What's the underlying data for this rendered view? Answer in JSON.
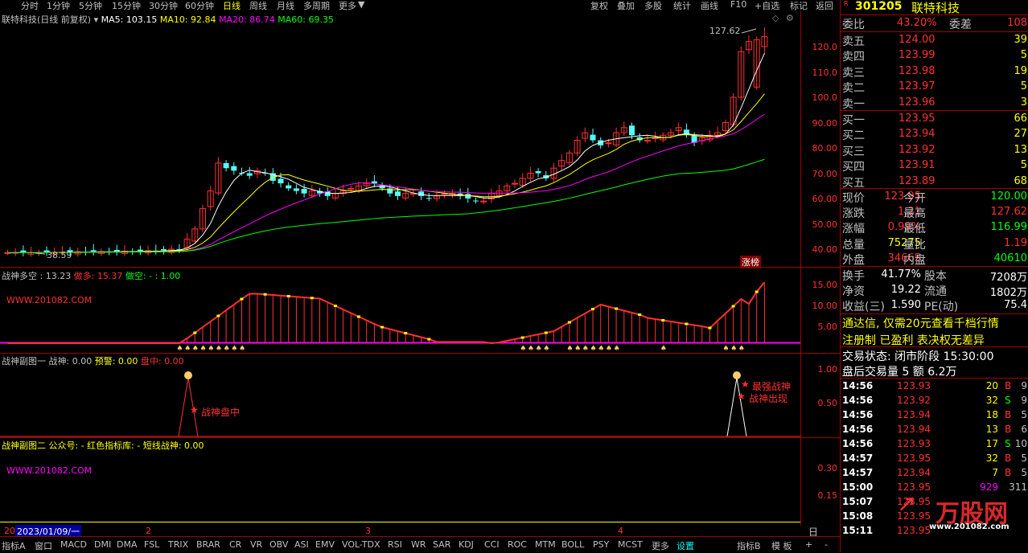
{
  "topbar": {
    "left_tabs": [
      "分时",
      "1分钟",
      "5分钟",
      "15分钟",
      "30分钟",
      "60分钟",
      "日线",
      "周线",
      "月线",
      "多周期",
      "更多"
    ],
    "active_tab": "日线",
    "right_tabs": [
      "复权",
      "叠加",
      "多股",
      "统计",
      "画线",
      "F10",
      "+自选",
      "标记",
      "返回"
    ]
  },
  "main_chart": {
    "stock_name": "联特科技(日线 前复权)",
    "ma_legend": [
      {
        "label": "MA5: 103.15",
        "color": "#ffffff"
      },
      {
        "label": "MA10: 92.84",
        "color": "#ffff00"
      },
      {
        "label": "MA20: 86.74",
        "color": "#ff00ff"
      },
      {
        "label": "MA60: 69.35",
        "color": "#00ff00"
      }
    ],
    "high_label": "127.62",
    "low_label": "38.59",
    "badge": "涨榜",
    "y_ticks": [
      "120.0",
      "110.0",
      "100.0",
      "90.00",
      "80.00",
      "70.00",
      "60.00",
      "50.00",
      "40.00"
    ]
  },
  "sub1": {
    "title": "战神多空 : 13.23",
    "duo": "做多: 15.37",
    "kong": "做空: - : 1.00",
    "watermark": "WWW.201082.COM",
    "y_ticks": [
      "15.00",
      "10.00",
      "5.00"
    ]
  },
  "sub2": {
    "title": "战神副图一  战神: 0.00",
    "warn": "预警: 0.00",
    "pan": "盘中: 0.00",
    "annotation1": "战神盘中",
    "annotation2": "最强战神",
    "annotation3": "战神出现",
    "y_ticks": [
      "1.00",
      "0.50"
    ]
  },
  "sub3": {
    "title": "战神副图二  公众号: -  红色指标库: -  短线战神: 0.00",
    "watermark": "WWW.201082.COM",
    "y_ticks": [
      "0.30",
      "0.15"
    ]
  },
  "datebar": {
    "cursor_date": "2023/01/09/一",
    "prefix": "20",
    "months": [
      "2",
      "3",
      "4"
    ],
    "right_label": "日线"
  },
  "bottombar": {
    "items": [
      "指标A",
      "窗口",
      "MACD",
      "DMI",
      "DMA",
      "FSL",
      "TRIX",
      "BRAR",
      "CR",
      "VR",
      "OBV",
      "ASI",
      "EMV",
      "VOL-TDX",
      "RSI",
      "WR",
      "SAR",
      "KDJ",
      "CCI",
      "ROC",
      "MTM",
      "BOLL",
      "PSY",
      "MCST",
      "更多",
      "设置"
    ],
    "active": "设置",
    "right_items": [
      "指标B",
      "模 板",
      "+",
      "-"
    ]
  },
  "quote": {
    "code": "301205",
    "name": "联特科技",
    "weibi_label": "委比",
    "weibi": "43.20%",
    "weicha_label": "委差",
    "weicha": "108",
    "asks": [
      {
        "label": "卖五",
        "price": "124.00",
        "vol": "39"
      },
      {
        "label": "卖四",
        "price": "123.99",
        "vol": "5"
      },
      {
        "label": "卖三",
        "price": "123.98",
        "vol": "19"
      },
      {
        "label": "卖二",
        "price": "123.97",
        "vol": "5"
      },
      {
        "label": "卖一",
        "price": "123.96",
        "vol": "3"
      }
    ],
    "bids": [
      {
        "label": "买一",
        "price": "123.95",
        "vol": "66"
      },
      {
        "label": "买二",
        "price": "123.94",
        "vol": "27"
      },
      {
        "label": "买三",
        "price": "123.92",
        "vol": "13"
      },
      {
        "label": "买四",
        "price": "123.91",
        "vol": "5"
      },
      {
        "label": "买五",
        "price": "123.89",
        "vol": "68"
      }
    ],
    "stats": [
      {
        "l1": "现价",
        "v1": "123.95",
        "c1": "#ff3030",
        "l2": "今开",
        "v2": "120.00",
        "c2": "#00ff00"
      },
      {
        "l1": "涨跌",
        "v1": "1.21",
        "c1": "#ff3030",
        "l2": "最高",
        "v2": "127.62",
        "c2": "#ff3030"
      },
      {
        "l1": "涨幅",
        "v1": "0.99%",
        "c1": "#ff3030",
        "l2": "最低",
        "v2": "116.99",
        "c2": "#00ff00"
      },
      {
        "l1": "总量",
        "v1": "75275",
        "c1": "#ffff00",
        "l2": "量比",
        "v2": "1.19",
        "c2": "#ff3030"
      },
      {
        "l1": "外盘",
        "v1": "34665",
        "c1": "#ff3030",
        "l2": "内盘",
        "v2": "40610",
        "c2": "#00ff00"
      }
    ],
    "stats2": [
      {
        "l1": "换手",
        "v1": "41.77%",
        "l2": "股本",
        "v2": "7208万"
      },
      {
        "l1": "净资",
        "v1": "19.22",
        "l2": "流通",
        "v2": "1802万"
      },
      {
        "l1": "收益(三)",
        "v1": "1.590",
        "l2": "PE(动)",
        "v2": "75.4"
      }
    ],
    "notice1": "通达信, 仅需20元查看千档行情",
    "notice2": "注册制 已盈利 表决权无差异",
    "trade_status": "交易状态: 闭市阶段 15:30:00",
    "after_hours": "盘后交易量 5 额 6.2万",
    "ticks": [
      {
        "t": "14:56",
        "p": "123.93",
        "v": "20",
        "s": "B",
        "n": "9"
      },
      {
        "t": "14:56",
        "p": "123.92",
        "v": "32",
        "s": "S",
        "n": "9"
      },
      {
        "t": "14:56",
        "p": "123.94",
        "v": "18",
        "s": "B",
        "n": "5"
      },
      {
        "t": "14:56",
        "p": "123.94",
        "v": "13",
        "s": "B",
        "n": "6"
      },
      {
        "t": "14:56",
        "p": "123.93",
        "v": "17",
        "s": "S",
        "n": "10"
      },
      {
        "t": "14:57",
        "p": "123.95",
        "v": "32",
        "s": "B",
        "n": "5"
      },
      {
        "t": "14:57",
        "p": "123.94",
        "v": "7",
        "s": "B",
        "n": "5"
      },
      {
        "t": "15:00",
        "p": "123.95",
        "v": "929",
        "s": "",
        "n": "311"
      },
      {
        "t": "15:07",
        "p": "123.95",
        "v": "",
        "s": "",
        "n": ""
      },
      {
        "t": "15:08",
        "p": "123.95",
        "v": "",
        "s": "",
        "n": ""
      },
      {
        "t": "15:11",
        "p": "123.95",
        "v": "",
        "s": "",
        "n": ""
      }
    ],
    "logo": "万股网",
    "logo_url": "www.201082.com"
  },
  "colors": {
    "up": "#ff3030",
    "down": "#54ffff",
    "grid": "#a00000"
  }
}
